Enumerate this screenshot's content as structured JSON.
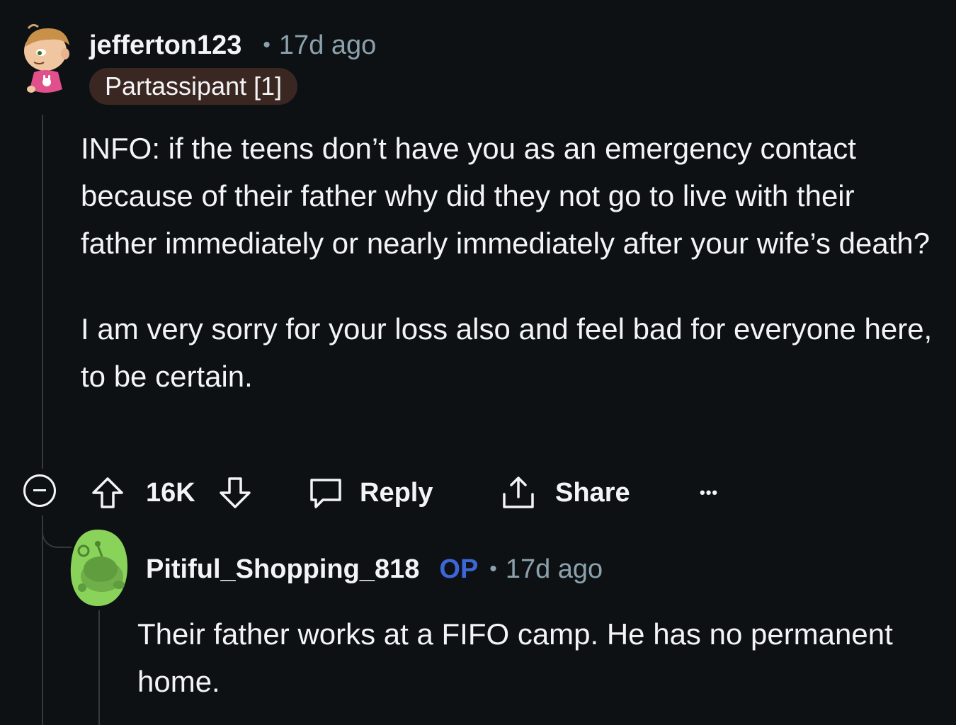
{
  "comment": {
    "username": "jefferton123",
    "separator": "•",
    "time": "17d ago",
    "flair": "Partassipant [1]",
    "paragraphs": [
      "INFO: if the teens don’t have you as an emergency contact because of their father why did they not go to live with their father immediately or nearly immediately after your wife’s death?",
      "I am very sorry for your loss also and feel bad for everyone here, to be certain."
    ],
    "actions": {
      "score": "16K",
      "reply_label": "Reply",
      "share_label": "Share",
      "more_label": "•••"
    }
  },
  "reply": {
    "username": "Pitiful_Shopping_818",
    "op_badge": "OP",
    "separator": "•",
    "time": "17d ago",
    "text": "Their father works at a FIFO camp. He has no permanent home."
  },
  "colors": {
    "background": "#0e1113",
    "text": "#f2f4f5",
    "meta": "#8ba2ad",
    "op_badge": "#3d66d9",
    "flair_bg": "#3a2722",
    "thread_line": "#33393e"
  }
}
